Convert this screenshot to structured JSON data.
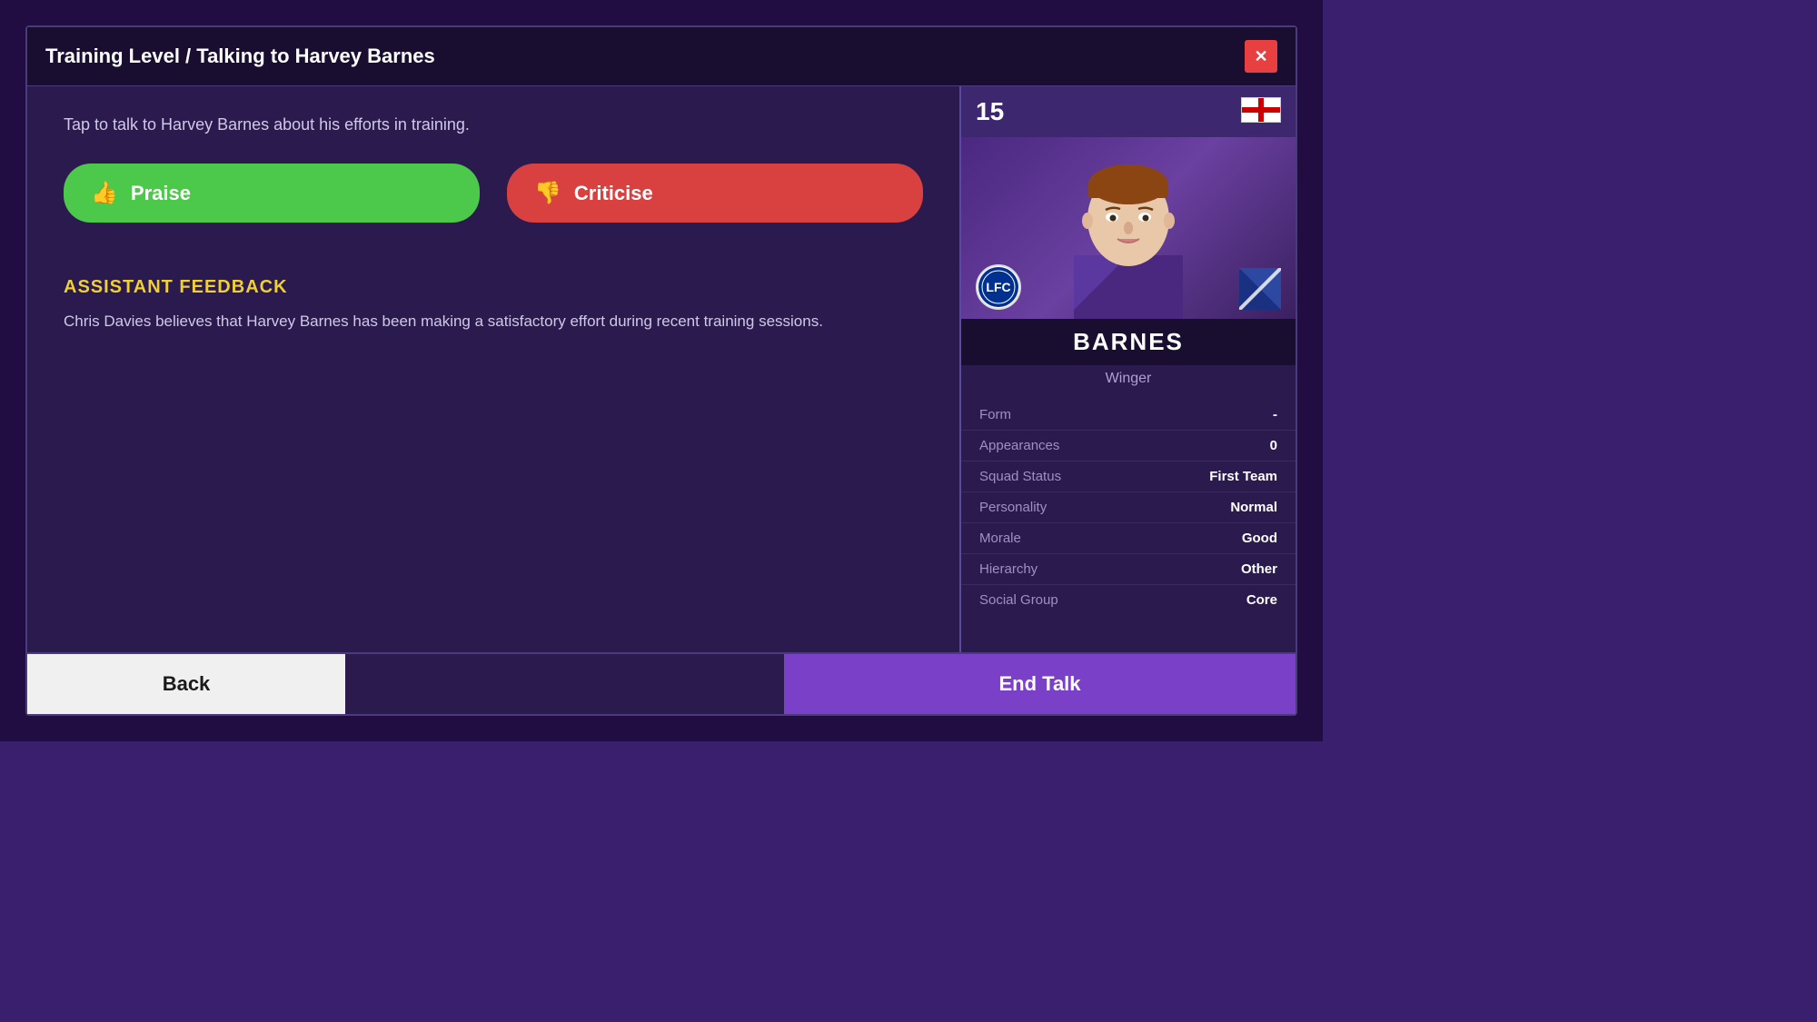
{
  "modal": {
    "title": "Training Level / Talking to Harvey Barnes",
    "close_label": "✕"
  },
  "description": {
    "text": "Tap to talk to Harvey Barnes about his efforts in training."
  },
  "buttons": {
    "praise_label": "Praise",
    "criticise_label": "Criticise",
    "back_label": "Back",
    "end_talk_label": "End Talk"
  },
  "assistant_feedback": {
    "title": "ASSISTANT FEEDBACK",
    "text": "Chris Davies believes that Harvey Barnes has been making a satisfactory effort during recent training sessions."
  },
  "player": {
    "number": "15",
    "name": "BARNES",
    "position": "Winger",
    "stats": {
      "form_label": "Form",
      "form_value": "-",
      "appearances_label": "Appearances",
      "appearances_value": "0",
      "squad_status_label": "Squad Status",
      "squad_status_value": "First Team",
      "personality_label": "Personality",
      "personality_value": "Normal",
      "morale_label": "Morale",
      "morale_value": "Good",
      "hierarchy_label": "Hierarchy",
      "hierarchy_value": "Other",
      "social_group_label": "Social Group",
      "social_group_value": "Core"
    }
  }
}
